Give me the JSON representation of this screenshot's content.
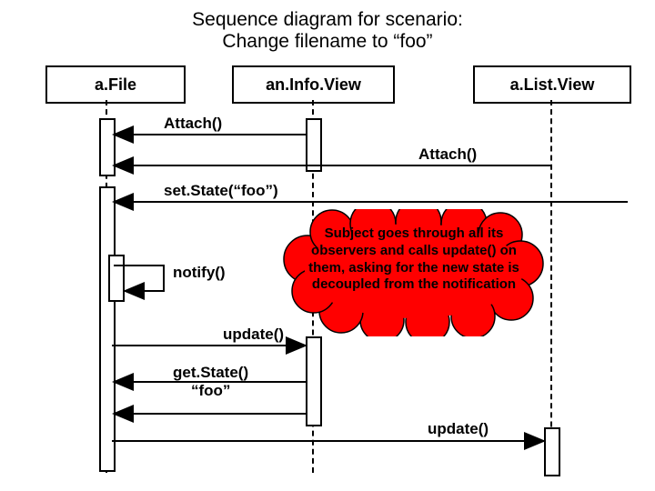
{
  "title": {
    "line1": "Sequence diagram for scenario:",
    "line2": "Change filename to “foo”"
  },
  "participants": {
    "file": "a.File",
    "info": "an.Info.View",
    "list": "a.List.View"
  },
  "messages": {
    "attach1": "Attach()",
    "attach2": "Attach()",
    "setState": "set.State(“foo”)",
    "notify": "notify()",
    "update1": "update()",
    "getState_line1": "get.State()",
    "getState_line2": "“foo”",
    "update2": "update()"
  },
  "note": "Subject goes through all its observers and calls update() on them, asking for the new state is decoupled from the notification"
}
